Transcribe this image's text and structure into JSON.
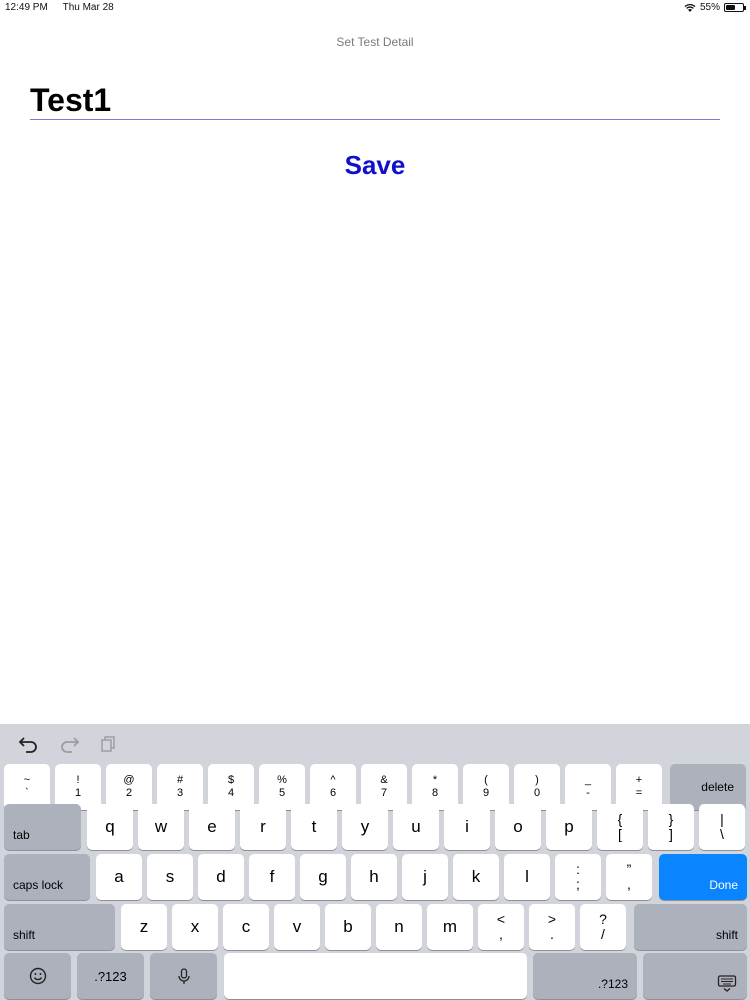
{
  "status": {
    "time": "12:49 PM",
    "date": "Thu Mar 28",
    "battery": "55%",
    "battery_level": 0.55
  },
  "nav": {
    "title": "Set Test Detail"
  },
  "form": {
    "value": "Test1",
    "save_label": "Save"
  },
  "keyboard": {
    "assistant": {
      "undo": "undo-icon",
      "redo": "redo-icon",
      "paste": "paste-icon"
    },
    "number_row": [
      {
        "top": "~",
        "bottom": "`"
      },
      {
        "top": "!",
        "bottom": "1"
      },
      {
        "top": "@",
        "bottom": "2"
      },
      {
        "top": "#",
        "bottom": "3"
      },
      {
        "top": "$",
        "bottom": "4"
      },
      {
        "top": "%",
        "bottom": "5"
      },
      {
        "top": "^",
        "bottom": "6"
      },
      {
        "top": "&",
        "bottom": "7"
      },
      {
        "top": "*",
        "bottom": "8"
      },
      {
        "top": "(",
        "bottom": "9"
      },
      {
        "top": ")",
        "bottom": "0"
      },
      {
        "top": "_",
        "bottom": "-"
      },
      {
        "top": "+",
        "bottom": "="
      }
    ],
    "delete": "delete",
    "tab": "tab",
    "row2": [
      "q",
      "w",
      "e",
      "r",
      "t",
      "y",
      "u",
      "i",
      "o",
      "p"
    ],
    "row2_symbols": [
      {
        "top": "{",
        "bottom": "["
      },
      {
        "top": "}",
        "bottom": "]"
      },
      {
        "top": "|",
        "bottom": "\\"
      }
    ],
    "caps_lock": "caps lock",
    "row3": [
      "a",
      "s",
      "d",
      "f",
      "g",
      "h",
      "j",
      "k",
      "l"
    ],
    "row3_symbols": [
      {
        "top": ":",
        "bottom": ";"
      },
      {
        "top": "”",
        "bottom": ","
      }
    ],
    "done": "Done",
    "shift": "shift",
    "row4": [
      "z",
      "x",
      "c",
      "v",
      "b",
      "n",
      "m"
    ],
    "row4_symbols": [
      {
        "top": "<",
        "bottom": ","
      },
      {
        "top": ">",
        "bottom": "."
      },
      {
        "top": "?",
        "bottom": "/"
      }
    ],
    "num_switch": ".?123",
    "icons": {
      "emoji": "emoji-icon",
      "mic": "microphone-icon",
      "hide": "keyboard-hide-icon"
    }
  },
  "colors": {
    "accent": "#1010cc",
    "done": "#0a84ff",
    "keyboard_bg": "#d2d4db"
  }
}
